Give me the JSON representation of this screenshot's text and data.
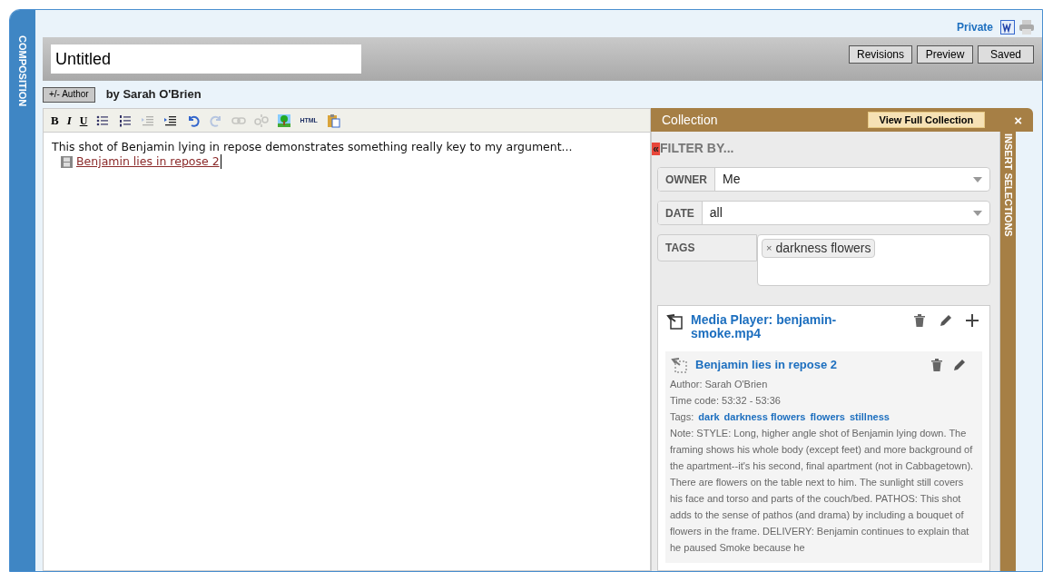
{
  "sidebar": {
    "label": "COMPOSITION"
  },
  "header": {
    "privacy": "Private"
  },
  "title_field": {
    "value": "Untitled"
  },
  "actions": [
    "Revisions",
    "Preview",
    "Saved"
  ],
  "author": {
    "button": "+/- Author",
    "byline": "by Sarah O'Brien"
  },
  "toolbar": [
    {
      "kind": "bold",
      "label": "B",
      "disabled": false
    },
    {
      "kind": "italic",
      "label": "I",
      "disabled": false
    },
    {
      "kind": "underline",
      "label": "U",
      "disabled": false
    },
    {
      "kind": "bullets",
      "disabled": false
    },
    {
      "kind": "numbers",
      "disabled": false
    },
    {
      "kind": "outdent",
      "disabled": true
    },
    {
      "kind": "indent",
      "disabled": false
    },
    {
      "kind": "undo",
      "disabled": false
    },
    {
      "kind": "redo",
      "disabled": true
    },
    {
      "kind": "link",
      "disabled": true
    },
    {
      "kind": "unlink",
      "disabled": true
    },
    {
      "kind": "image",
      "disabled": false
    },
    {
      "kind": "html",
      "label": "HTML",
      "disabled": false
    },
    {
      "kind": "paste",
      "disabled": false
    }
  ],
  "editor": {
    "text": "This shot of Benjamin lying in repose demonstrates something really key to my argument...",
    "link": "Benjamin lies in repose 2"
  },
  "collection": {
    "title": "Collection",
    "view_button": "View Full Collection",
    "close": "×",
    "side_tab": "INSERT SELECTIONS",
    "filter_toggle": "«",
    "filter_title": "FILTER BY...",
    "filters": [
      {
        "label": "OWNER",
        "value": "Me"
      },
      {
        "label": "DATE",
        "value": "all"
      }
    ],
    "tags": {
      "label": "TAGS",
      "chips": [
        {
          "remove": "×",
          "text": "darkness flowers"
        }
      ]
    },
    "item": {
      "title": "Media Player: benjamin-smoke.mp4",
      "annotation": {
        "title": "Benjamin lies in repose 2",
        "author": "Author: Sarah O'Brien",
        "timecode": "Time code: 53:32 - 53:36",
        "tags_label": "Tags:",
        "tags": [
          "dark",
          "darkness flowers",
          "flowers",
          "stillness"
        ],
        "note": "Note: STYLE: Long, higher angle shot of Benjamin lying down. The framing shows his whole body (except feet) and more background of the apartment--it's his second, final apartment (not in Cabbagetown). There are flowers on the table next to him. The sunlight still covers his face and torso and parts of the couch/bed. PATHOS: This shot adds to the sense of pathos (and drama) by including a bouquet of flowers in the frame. DELIVERY: Benjamin continues to explain that he paused Smoke because he"
      }
    }
  }
}
